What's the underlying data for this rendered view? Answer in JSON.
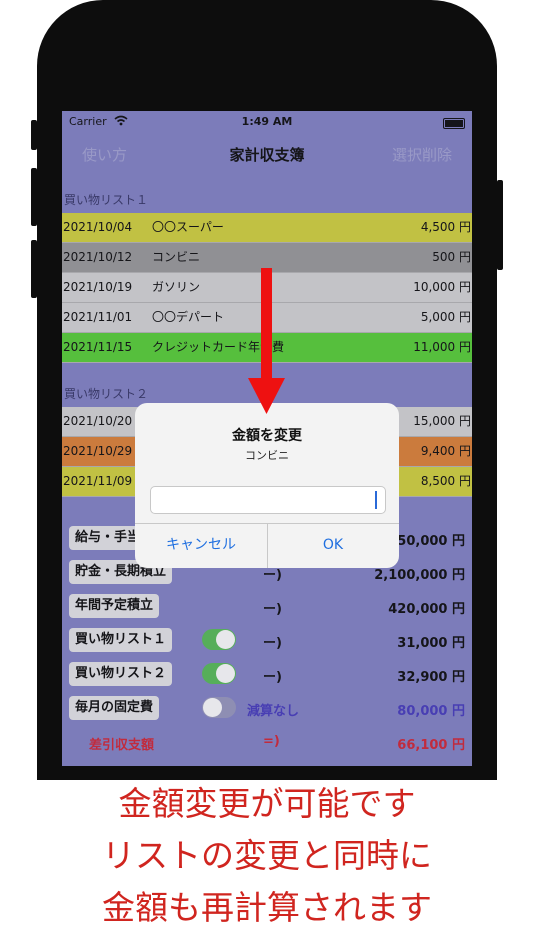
{
  "status_bar": {
    "carrier": "Carrier",
    "time": "1:49 AM"
  },
  "navbar": {
    "left": "使い方",
    "title": "家計収支簿",
    "right": "選択削除"
  },
  "list1": {
    "header": "買い物リスト１",
    "rows": [
      {
        "date": "2021/10/04",
        "name": "〇〇スーパー",
        "amount": "4,500 円",
        "color": "#d4d440"
      },
      {
        "date": "2021/10/12",
        "name": "コンビニ",
        "amount": "500 円",
        "color": "#9d9d9d"
      },
      {
        "date": "2021/10/19",
        "name": "ガソリン",
        "amount": "10,000 円",
        "color": "#d6d6d6"
      },
      {
        "date": "2021/11/01",
        "name": "〇〇デパート",
        "amount": "5,000 円",
        "color": "#d6d6d6"
      },
      {
        "date": "2021/11/15",
        "name": "クレジットカード年会費",
        "amount": "11,000 円",
        "color": "#5ad23a"
      }
    ]
  },
  "list2": {
    "header": "買い物リスト２",
    "rows": [
      {
        "date": "2021/10/20",
        "name": "",
        "amount": "15,000 円",
        "color": "#d6d6d6"
      },
      {
        "date": "2021/10/29",
        "name": "",
        "amount": "9,400 円",
        "color": "#e0843a"
      },
      {
        "date": "2021/11/09",
        "name": "",
        "amount": "8,500 円",
        "color": "#d4d440"
      }
    ]
  },
  "summary": [
    {
      "label": "給与・手当",
      "toggle": null,
      "op": "",
      "amount": "150,000 円"
    },
    {
      "label": "貯金・長期積立",
      "toggle": null,
      "op": "ー)",
      "amount": "2,100,000 円"
    },
    {
      "label": "年間予定積立",
      "toggle": null,
      "op": "ー)",
      "amount": "420,000 円"
    },
    {
      "label": "買い物リスト１",
      "toggle": "on",
      "op": "ー)",
      "amount": "31,000 円"
    },
    {
      "label": "買い物リスト２",
      "toggle": "on",
      "op": "ー)",
      "amount": "32,900 円"
    },
    {
      "label": "毎月の固定費",
      "toggle": "off",
      "op": "減算なし",
      "amount": "80,000 円"
    }
  ],
  "balance": {
    "label": "差引収支額",
    "op": "=)",
    "amount": "66,100 円"
  },
  "dialog": {
    "title": "金額を変更",
    "subtitle": "コンビニ",
    "input_value": "",
    "cancel": "キャンセル",
    "ok": "OK"
  },
  "caption": [
    "金額変更が可能です",
    "リストの変更と同時に",
    "金額も再計算されます"
  ],
  "colors": {
    "screen_bg": "#8686c8",
    "accent_blue": "#1f6fe0",
    "caption_red": "#d0251f",
    "arrow_red": "#ee1111"
  }
}
